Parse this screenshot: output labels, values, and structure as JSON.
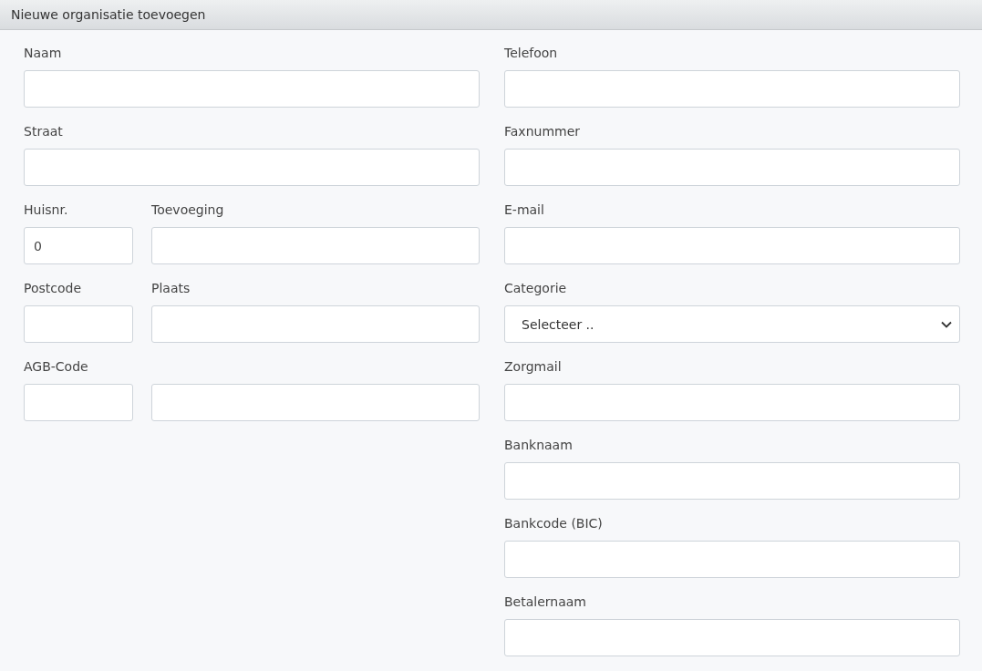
{
  "window": {
    "title": "Nieuwe organisatie toevoegen"
  },
  "left_rows": [
    {
      "fields": [
        {
          "kind": "text",
          "label": "Naam"
        }
      ]
    },
    {
      "fields": [
        {
          "kind": "text",
          "label": "Straat"
        }
      ]
    },
    {
      "fields": [
        {
          "kind": "text",
          "label": "Huisnr.",
          "value": "0"
        },
        {
          "kind": "text",
          "label": "Toevoeging"
        }
      ]
    },
    {
      "fields": [
        {
          "kind": "text",
          "label": "Postcode"
        },
        {
          "kind": "text",
          "label": "Plaats"
        }
      ]
    },
    {
      "fields": [
        {
          "kind": "text",
          "label": "AGB-Code"
        },
        {
          "kind": "text"
        }
      ]
    }
  ],
  "right_fields": [
    {
      "kind": "text",
      "label": "Telefoon"
    },
    {
      "kind": "text",
      "label": "Faxnummer"
    },
    {
      "kind": "text",
      "label": "E-mail"
    },
    {
      "kind": "select",
      "label": "Categorie",
      "value": "Selecteer .."
    },
    {
      "kind": "text",
      "label": "Zorgmail"
    },
    {
      "kind": "text",
      "label": "Banknaam"
    },
    {
      "kind": "text",
      "label": "Bankcode (BIC)"
    },
    {
      "kind": "text",
      "label": "Betalernaam"
    }
  ]
}
